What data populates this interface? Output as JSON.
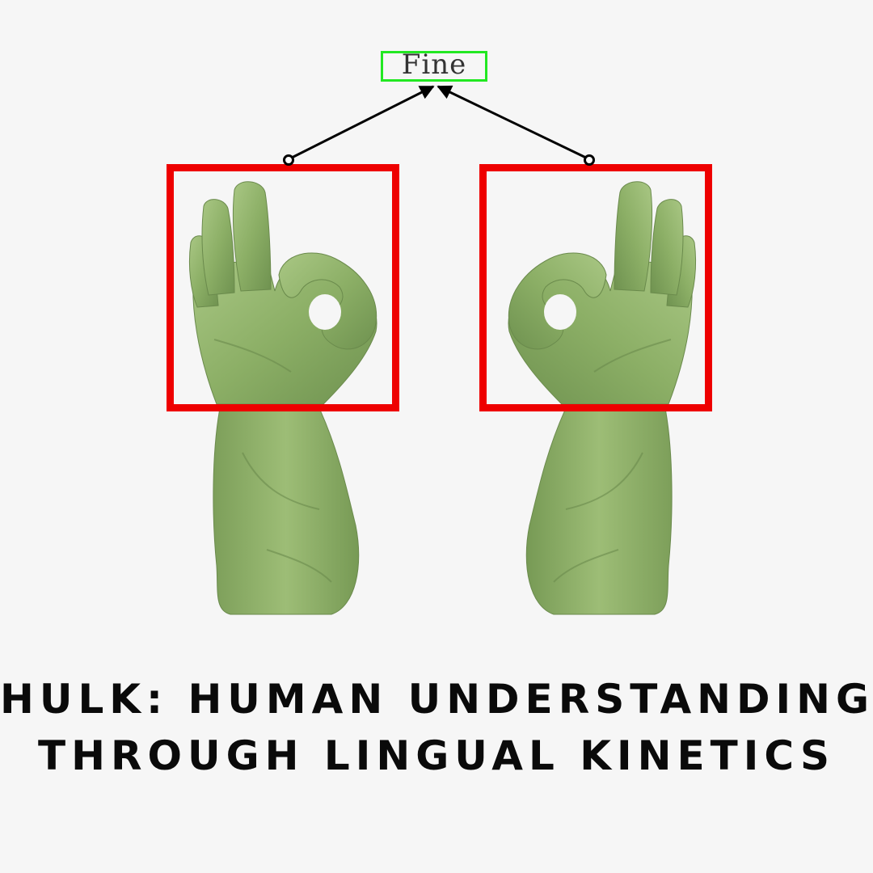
{
  "gesture_label": "Fine",
  "title": {
    "line1": "HULK: HUMAN UNDERSTANDING",
    "line2": "THROUGH LINGUAL KINETICS"
  },
  "images": {
    "left_hand": "hand-ok-gesture-icon",
    "right_hand": "hand-ok-gesture-icon"
  },
  "colors": {
    "background": "#f6f6f6",
    "detection_box": "#ee0000",
    "label_box": "#22e822",
    "arrow": "#000000",
    "hand_skin": "#8fb06a",
    "title_text": "#0a0a0a"
  }
}
